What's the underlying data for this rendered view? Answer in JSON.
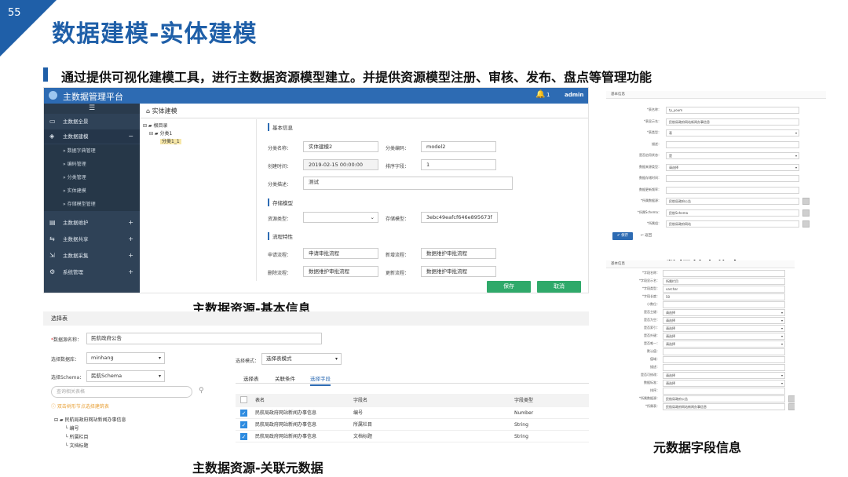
{
  "slide": {
    "page_number": "55",
    "title": "数据建模-实体建模",
    "subtitle": "通过提供可视化建模工具，进行主数据资源模型建立。并提供资源模型注册、审核、发布、盘点等管理功能"
  },
  "captions": {
    "basic_info": "主数据资源-基本信息",
    "related_metadata": "主数据资源-关联元数据",
    "meta_basic": "元数据基本信息",
    "meta_field": "元数据字段信息"
  },
  "screen1": {
    "app_title": "主数据管理平台",
    "notify_count": "1",
    "user": "admin",
    "breadcrumb": "实体建模",
    "sidebar": {
      "items": [
        {
          "label": "主数据全景",
          "icon": "monitor-icon"
        },
        {
          "label": "主数据建模",
          "icon": "cube-icon",
          "toggle": "−"
        },
        {
          "label": "主数据维护",
          "icon": "edit-icon",
          "toggle": "+"
        },
        {
          "label": "主数据共享",
          "icon": "share-icon",
          "toggle": "+"
        },
        {
          "label": "主数据采集",
          "icon": "collect-icon",
          "toggle": "+"
        },
        {
          "label": "系统管理",
          "icon": "gear-icon",
          "toggle": "+"
        }
      ],
      "subitems": [
        "数据字典管理",
        "编码管理",
        "分类管理",
        "实体建模",
        "存储模型管理"
      ]
    },
    "tree": {
      "root": "根目录",
      "child": "分类1",
      "leaf": "分类1_1"
    },
    "sections": {
      "basic": "基本信息",
      "storage": "存储模型",
      "process": "流程特性"
    },
    "fields": {
      "cat_name_label": "分类名称：",
      "cat_name_value": "实体建模2",
      "cat_code_label": "分类编码：",
      "cat_code_value": "model2",
      "created_label": "创建时间：",
      "created_value": "2019-02-15 00:00:00",
      "sort_label": "排序字段：",
      "sort_value": "1",
      "desc_label": "分类描述：",
      "desc_value": "测试",
      "res_type_label": "资源类型：",
      "storage_model_label": "存储模型：",
      "storage_model_value": "3ebc49eafcf646e895673f",
      "apply_label": "申请流程：",
      "apply_value": "申请审批流程",
      "add_label": "新增流程：",
      "add_value": "数据维护审批流程",
      "delete_label": "删除流程：",
      "delete_value": "数据维护审批流程",
      "update_label": "更新流程：",
      "update_value": "数据维护审批流程"
    },
    "buttons": {
      "save": "保存",
      "cancel": "取消"
    }
  },
  "screen2": {
    "header": "选择表",
    "source_name_label": "数据源名称：",
    "source_name_value": "民航政府公告",
    "db_label": "选择数据库：",
    "db_value": "minhang",
    "schema_label": "选择Schema：",
    "schema_value": "民航Schema",
    "mode_label": "选择模式：",
    "mode_value": "选择表模式",
    "search_placeholder": "查询相关表格",
    "tip": "双击树形节点选择建筑表",
    "tree": {
      "root": "民航局政府网站新闻办事信息",
      "fields": [
        "编号",
        "所属栏目",
        "文档标题"
      ]
    },
    "tabs": [
      "选择表",
      "关联条件",
      "选择字段"
    ],
    "table": {
      "headers": [
        "表名",
        "字段名",
        "字段类型"
      ],
      "rows": [
        [
          "民航局政府网站新闻办事信息",
          "编号",
          "Number"
        ],
        [
          "民航局政府网站新闻办事信息",
          "所属栏目",
          "String"
        ],
        [
          "民航局政府网站新闻办事信息",
          "文档标题",
          "String"
        ]
      ]
    }
  },
  "screen3": {
    "header": "基本信息",
    "rows": [
      {
        "label": "*表名称：",
        "value": "ty_youm"
      },
      {
        "label": "*表显示名：",
        "value": "民航局政府网站新闻办事信息"
      },
      {
        "label": "*表类型：",
        "value": "表"
      },
      {
        "label": "描述：",
        "value": ""
      },
      {
        "label": "是否启用状态：",
        "value": "是"
      },
      {
        "label": "数据来源类型：",
        "value": "请选择"
      },
      {
        "label": "数据存储时间：",
        "value": ""
      },
      {
        "label": "数据更新频率：",
        "value": ""
      },
      {
        "label": "*所属数据源：",
        "value": "民航局政府公告"
      },
      {
        "label": "*所属Schema：",
        "value": "民航Schema"
      },
      {
        "label": "*所属组：",
        "value": "民航局政府网站"
      }
    ],
    "save": "保存",
    "back": "返回"
  },
  "screen4": {
    "header": "基本信息",
    "rows": [
      {
        "label": "*字段名称：",
        "value": ""
      },
      {
        "label": "*字段显示名：",
        "value": "所属栏目"
      },
      {
        "label": "*字段类型：",
        "value": "varchar"
      },
      {
        "label": "*字段长度：",
        "value": "50"
      },
      {
        "label": "小数位：",
        "value": ""
      },
      {
        "label": "是否主键：",
        "value": "请选择"
      },
      {
        "label": "是否为空：",
        "value": "请选择"
      },
      {
        "label": "是否索引：",
        "value": "请选择"
      },
      {
        "label": "是否外键：",
        "value": "请选择"
      },
      {
        "label": "是否唯一：",
        "value": "请选择"
      },
      {
        "label": "默认值：",
        "value": ""
      },
      {
        "label": "值域：",
        "value": ""
      },
      {
        "label": "描述：",
        "value": ""
      },
      {
        "label": "是否可修改：",
        "value": "请选择"
      },
      {
        "label": "数据标准：",
        "value": "请选择"
      },
      {
        "label": "排序：",
        "value": ""
      },
      {
        "label": "*所属数据源：",
        "value": "民航局政府公告"
      },
      {
        "label": "*所属表：",
        "value": "民航局政府网站新闻办事信息"
      }
    ]
  },
  "colors": {
    "brand_blue": "#1f5fa8",
    "sidebar_dark": "#2f4257",
    "button_green": "#2fa96a"
  }
}
